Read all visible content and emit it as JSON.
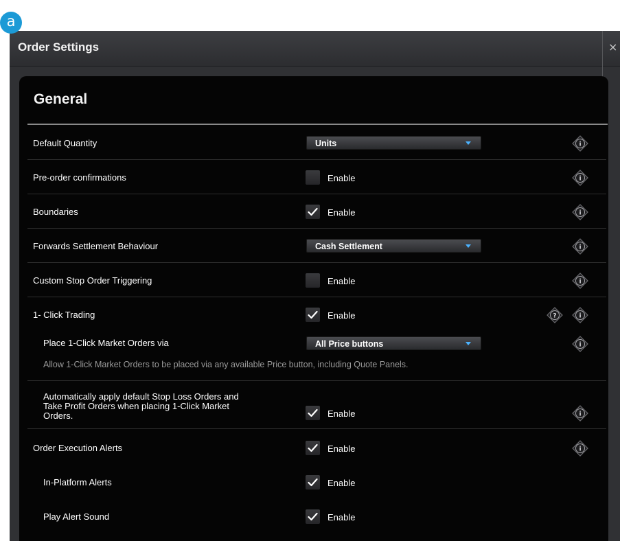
{
  "badge": "a",
  "window": {
    "title": "Order Settings",
    "close_glyph": "×"
  },
  "section": {
    "title": "General"
  },
  "rows": {
    "default_quantity": {
      "label": "Default Quantity",
      "control": "dropdown",
      "value": "Units"
    },
    "pre_order": {
      "label": "Pre-order confirmations",
      "control": "checkbox",
      "checked": false,
      "enable_label": "Enable"
    },
    "boundaries": {
      "label": "Boundaries",
      "control": "checkbox",
      "checked": true,
      "enable_label": "Enable"
    },
    "forwards": {
      "label": "Forwards Settlement Behaviour",
      "control": "dropdown",
      "value": "Cash Settlement"
    },
    "custom_stop": {
      "label": "Custom Stop Order Triggering",
      "control": "checkbox",
      "checked": false,
      "enable_label": "Enable"
    },
    "one_click": {
      "label": "1- Click Trading",
      "control": "checkbox",
      "checked": true,
      "enable_label": "Enable"
    },
    "place_via": {
      "label": "Place 1-Click Market Orders via",
      "control": "dropdown",
      "value": "All Price buttons",
      "description": "Allow 1-Click Market Orders to be placed via any available Price button, including Quote Panels."
    },
    "auto_apply": {
      "label_lines": [
        "Automatically apply default Stop Loss Orders and",
        "Take Profit Orders when placing 1-Click Market",
        "Orders."
      ],
      "control": "checkbox",
      "checked": true,
      "enable_label": "Enable"
    },
    "exec_alerts": {
      "label": "Order Execution Alerts",
      "control": "checkbox",
      "checked": true,
      "enable_label": "Enable"
    },
    "in_platform": {
      "label": "In-Platform Alerts",
      "control": "checkbox",
      "checked": true,
      "enable_label": "Enable"
    },
    "alert_sound": {
      "label": "Play Alert Sound",
      "control": "checkbox",
      "checked": true,
      "enable_label": "Enable"
    }
  },
  "icons": {
    "info": "info-icon",
    "help": "question-icon",
    "checkmark": "checkmark-icon",
    "dropdown_arrow": "chevron-down-icon"
  },
  "colors": {
    "badge": "#1c9ad6",
    "panel_bg": "#050505",
    "window_bg": "#303134",
    "dropdown_arrow": "#4bb3ff",
    "text": "#ffffff",
    "description_text": "#9a9a9a"
  }
}
